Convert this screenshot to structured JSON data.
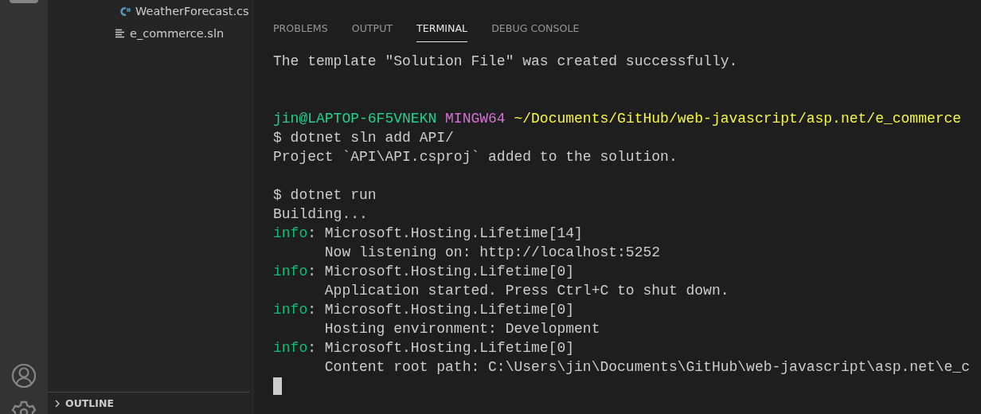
{
  "explorer": {
    "files": [
      {
        "name": "WeatherForecast.cs",
        "kind": "csharp"
      },
      {
        "name": "e_commerce.sln",
        "kind": "solution"
      }
    ],
    "outline": {
      "label": "OUTLINE",
      "expanded": false
    }
  },
  "panel": {
    "tabs": [
      {
        "label": "PROBLEMS",
        "selected": false
      },
      {
        "label": "OUTPUT",
        "selected": false
      },
      {
        "label": "TERMINAL",
        "selected": true
      },
      {
        "label": "DEBUG CONSOLE",
        "selected": false
      }
    ]
  },
  "terminal": {
    "lines": [
      {
        "kind": "text",
        "segments": [
          {
            "kind": "plain",
            "text": "The template \"Solution File\" was created successfully."
          }
        ]
      },
      {
        "kind": "blank"
      },
      {
        "kind": "blank"
      },
      {
        "kind": "text",
        "segments": [
          {
            "kind": "user",
            "text": "jin@LAPTOP-6F5VNEKN"
          },
          {
            "kind": "shell",
            "text": "MINGW64"
          },
          {
            "kind": "path",
            "text": "~/Documents/GitHub/web-javascript/asp.net/e_commerce"
          }
        ]
      },
      {
        "kind": "text",
        "segments": [
          {
            "kind": "plain",
            "text": "$ dotnet sln add API/"
          }
        ]
      },
      {
        "kind": "text",
        "segments": [
          {
            "kind": "plain",
            "text": "Project `API\\API.csproj` added to the solution."
          }
        ]
      },
      {
        "kind": "blank"
      },
      {
        "kind": "text",
        "segments": [
          {
            "kind": "plain",
            "text": "$ dotnet run"
          }
        ]
      },
      {
        "kind": "text",
        "segments": [
          {
            "kind": "plain",
            "text": "Building..."
          }
        ]
      },
      {
        "kind": "text",
        "segments": [
          {
            "kind": "info",
            "text": "info"
          },
          {
            "kind": "plain",
            "text": ": Microsoft.Hosting.Lifetime[14]"
          }
        ]
      },
      {
        "kind": "text",
        "segments": [
          {
            "kind": "plain",
            "text": "      Now listening on: http://localhost:5252"
          }
        ]
      },
      {
        "kind": "text",
        "segments": [
          {
            "kind": "info",
            "text": "info"
          },
          {
            "kind": "plain",
            "text": ": Microsoft.Hosting.Lifetime[0]"
          }
        ]
      },
      {
        "kind": "text",
        "segments": [
          {
            "kind": "plain",
            "text": "      Application started. Press Ctrl+C to shut down."
          }
        ]
      },
      {
        "kind": "text",
        "segments": [
          {
            "kind": "info",
            "text": "info"
          },
          {
            "kind": "plain",
            "text": ": Microsoft.Hosting.Lifetime[0]"
          }
        ]
      },
      {
        "kind": "text",
        "segments": [
          {
            "kind": "plain",
            "text": "      Hosting environment: Development"
          }
        ]
      },
      {
        "kind": "text",
        "segments": [
          {
            "kind": "info",
            "text": "info"
          },
          {
            "kind": "plain",
            "text": ": Microsoft.Hosting.Lifetime[0]"
          }
        ]
      },
      {
        "kind": "text",
        "segments": [
          {
            "kind": "plain",
            "text": "      Content root path: C:\\Users\\jin\\Documents\\GitHub\\web-javascript\\asp.net\\e_c"
          }
        ]
      }
    ]
  }
}
